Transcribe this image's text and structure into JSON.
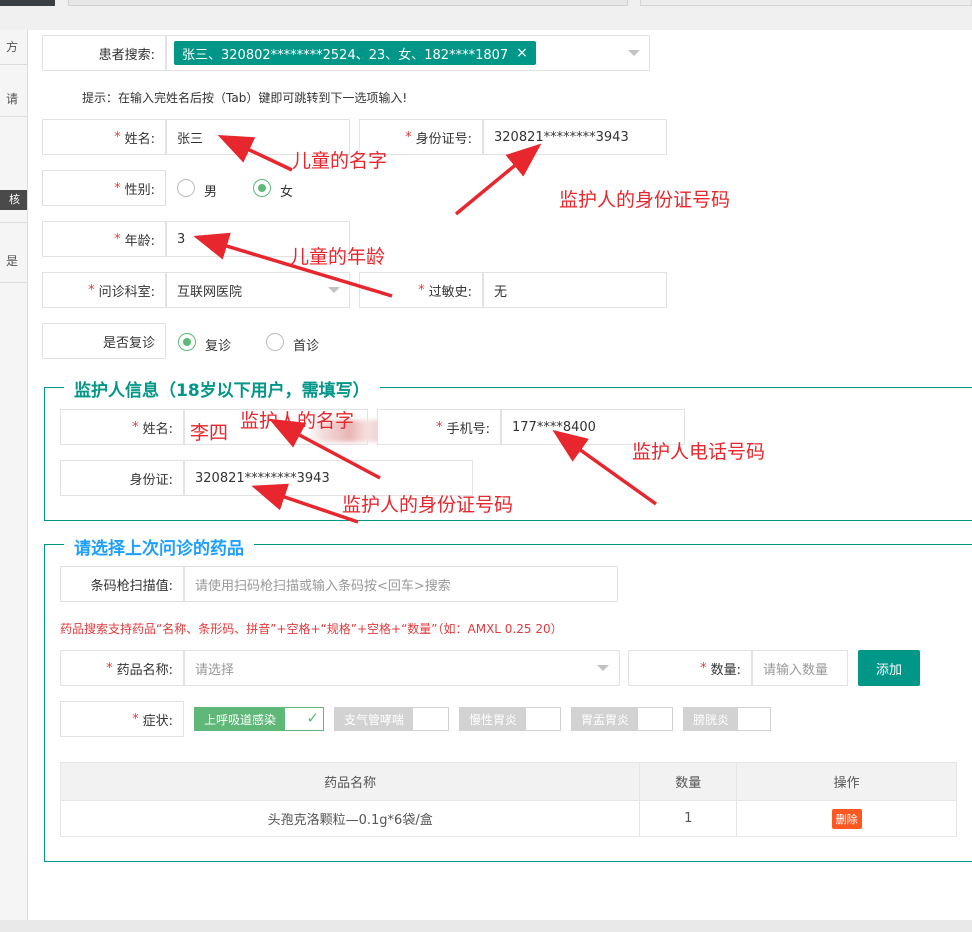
{
  "sidebar": {
    "t1": "方",
    "t2": "请",
    "t3": "核",
    "t4": "是"
  },
  "patient_search": {
    "label": "患者搜索:",
    "tag": "张三、320802********2524、23、女、182****1807"
  },
  "tip": "提示：在输入完姓名后按（Tab）键即可跳转到下一选项输入!",
  "patient": {
    "name_label": "姓名:",
    "name": "张三",
    "idcard_label": "身份证号:",
    "idcard": "320821********3943",
    "gender_label": "性别:",
    "gender_male": "男",
    "gender_female": "女",
    "age_label": "年龄:",
    "age": "3",
    "dept_label": "问诊科室:",
    "dept": "互联网医院",
    "allergy_label": "过敏史:",
    "allergy": "无",
    "revisit_label": "是否复诊",
    "revisit_yes": "复诊",
    "revisit_first": "首诊"
  },
  "guardian": {
    "legend": "监护人信息（18岁以下用户，需填写）",
    "name_label": "姓名:",
    "name": "李四",
    "phone_label": "手机号:",
    "phone": "177****8400",
    "idcard_label": "身份证:",
    "idcard": "320821********3943"
  },
  "drugs": {
    "legend": "请选择上次问诊的药品",
    "barcode_label": "条码枪扫描值:",
    "barcode_placeholder": "请使用扫码枪扫描或输入条码按<回车>搜索",
    "hint": "药品搜索支持药品“名称、条形码、拼音”+空格+“规格”+空格+“数量”（如：AMXL 0.25 20）",
    "name_label": "药品名称:",
    "name_placeholder": "请选择",
    "qty_label": "数量:",
    "qty_placeholder": "请输入数量",
    "add_button": "添加",
    "symptom_label": "症状:",
    "symptoms": [
      "上呼吸道感染",
      "支气管哮喘",
      "慢性胃炎",
      "胃盂胃炎",
      "膀胱炎"
    ],
    "table": {
      "headers": [
        "药品名称",
        "数量",
        "操作"
      ],
      "rows": [
        {
          "name": "头孢克洛颗粒—0.1g*6袋/盒",
          "qty": "1",
          "action": "删除"
        }
      ]
    }
  },
  "annotations": {
    "child_name": "儿童的名字",
    "guardian_idcard_1": "监护人的身份证号码",
    "child_age": "儿童的年龄",
    "guardian_name": "监护人的名字",
    "guardian_phone": "监护人电话号码",
    "guardian_idcard_2": "监护人的身份证号码"
  },
  "colors": {
    "primary": "#009688",
    "success": "#5fb878",
    "danger": "#e4393c",
    "annotation": "#e8262d",
    "delete": "#ff5722"
  }
}
